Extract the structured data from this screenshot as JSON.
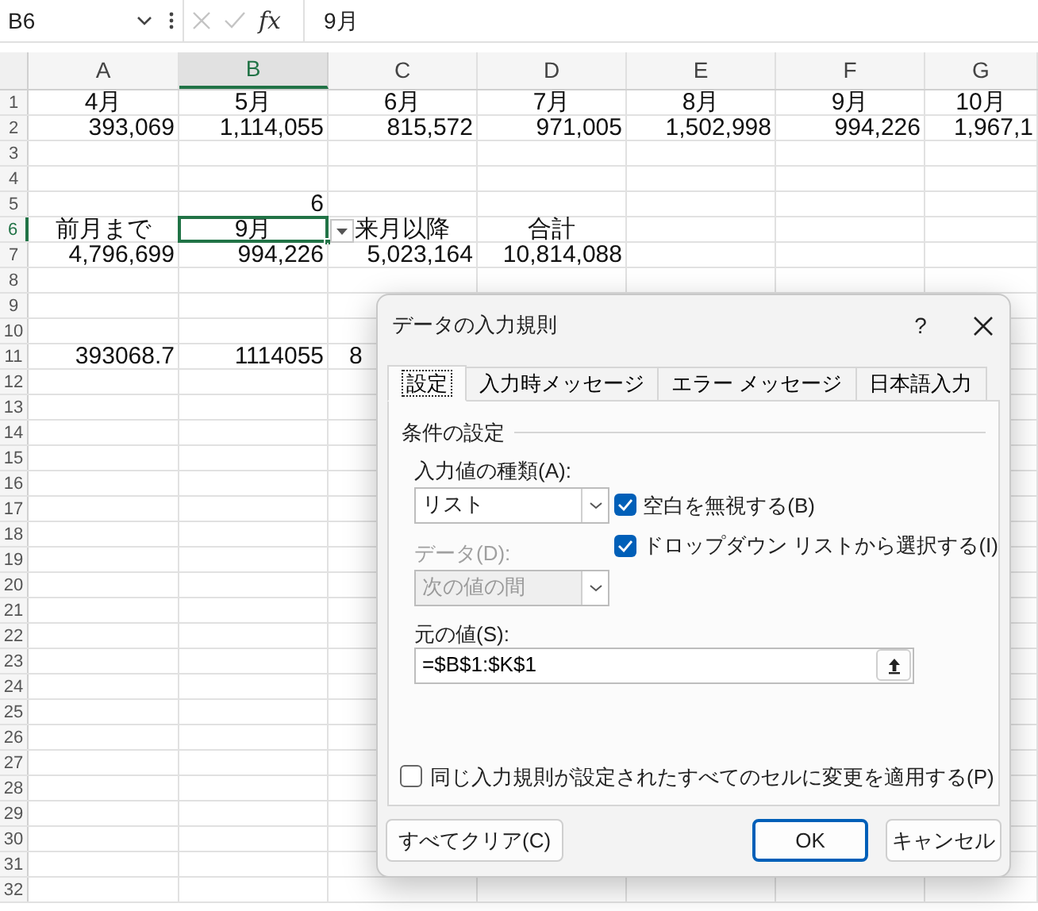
{
  "name_box": {
    "value": "B6"
  },
  "formula_bar": {
    "function_label": "fx",
    "value": "9月"
  },
  "columns": [
    {
      "label": "A",
      "selected": false
    },
    {
      "label": "B",
      "selected": true
    },
    {
      "label": "C",
      "selected": false
    },
    {
      "label": "D",
      "selected": false
    },
    {
      "label": "E",
      "selected": false
    },
    {
      "label": "F",
      "selected": false
    },
    {
      "label": "G",
      "selected": false
    }
  ],
  "rows": [
    {
      "number": "1",
      "selected": false,
      "kind": "header",
      "cells": [
        "4月",
        "5月",
        "6月",
        "7月",
        "8月",
        "9月",
        "10月"
      ]
    },
    {
      "number": "2",
      "selected": false,
      "kind": "values",
      "cells": [
        "393,069",
        "1,114,055",
        "815,572",
        "971,005",
        "1,502,998",
        "994,226",
        "1,967,1"
      ]
    },
    {
      "number": "3",
      "selected": false
    },
    {
      "number": "4",
      "selected": false
    },
    {
      "number": "5",
      "selected": false,
      "kind": "values",
      "cells": [
        null,
        "6"
      ]
    },
    {
      "number": "6",
      "selected": true,
      "kind": "header",
      "cells": [
        "前月まで",
        "9月",
        "来月以降",
        "合計"
      ]
    },
    {
      "number": "7",
      "selected": false,
      "kind": "values",
      "cells": [
        "4,796,699",
        "994,226",
        "5,023,164",
        "10,814,088"
      ]
    },
    {
      "number": "8",
      "selected": false
    },
    {
      "number": "9",
      "selected": false
    },
    {
      "number": "10",
      "selected": false
    },
    {
      "number": "11",
      "selected": false,
      "kind": "values",
      "cells": [
        "393068.7",
        "1114055",
        {
          "text": "8",
          "cut": true
        }
      ]
    },
    {
      "number": "12",
      "selected": false
    },
    {
      "number": "13",
      "selected": false
    },
    {
      "number": "14",
      "selected": false
    },
    {
      "number": "15",
      "selected": false
    },
    {
      "number": "16",
      "selected": false
    },
    {
      "number": "17",
      "selected": false
    },
    {
      "number": "18",
      "selected": false
    },
    {
      "number": "19",
      "selected": false
    },
    {
      "number": "20",
      "selected": false
    },
    {
      "number": "21",
      "selected": false
    },
    {
      "number": "22",
      "selected": false
    },
    {
      "number": "23",
      "selected": false
    },
    {
      "number": "24",
      "selected": false
    },
    {
      "number": "25",
      "selected": false
    },
    {
      "number": "26",
      "selected": false
    },
    {
      "number": "27",
      "selected": false
    },
    {
      "number": "28",
      "selected": false
    },
    {
      "number": "29",
      "selected": false
    },
    {
      "number": "30",
      "selected": false
    },
    {
      "number": "31",
      "selected": false
    },
    {
      "number": "32",
      "selected": false
    }
  ],
  "dialog": {
    "title": "データの入力規則",
    "help": "?",
    "tabs": [
      {
        "label": "設定",
        "selected": true
      },
      {
        "label": "入力時メッセージ",
        "selected": false
      },
      {
        "label": "エラー メッセージ",
        "selected": false
      },
      {
        "label": "日本語入力",
        "selected": false
      }
    ],
    "group_title": "条件の設定",
    "allow": {
      "label": "入力値の種類(A):",
      "value": "リスト",
      "disabled": false
    },
    "data": {
      "label": "データ(D):",
      "value": "次の値の間",
      "disabled": true
    },
    "checkboxes": [
      {
        "label": "空白を無視する(B)",
        "checked": true
      },
      {
        "label": "ドロップダウン リストから選択する(I)",
        "checked": true
      }
    ],
    "source": {
      "label": "元の値(S):",
      "value": "=$B$1:$K$1"
    },
    "apply_all": {
      "label": "同じ入力規則が設定されたすべてのセルに変更を適用する(P)",
      "checked": false
    },
    "buttons": [
      {
        "label": "すべてクリア(C)",
        "default": false
      },
      {
        "label": "OK",
        "default": true
      },
      {
        "label": "キャンセル",
        "default": false
      }
    ]
  }
}
